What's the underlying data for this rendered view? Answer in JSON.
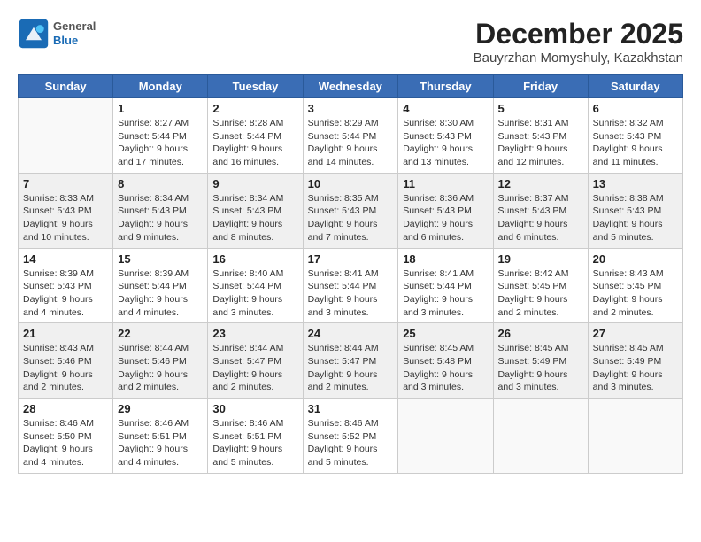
{
  "logo": {
    "general": "General",
    "blue": "Blue"
  },
  "title": "December 2025",
  "subtitle": "Bauyrzhan Momyshuly, Kazakhstan",
  "days_of_week": [
    "Sunday",
    "Monday",
    "Tuesday",
    "Wednesday",
    "Thursday",
    "Friday",
    "Saturday"
  ],
  "weeks": [
    [
      {
        "day": "",
        "info": ""
      },
      {
        "day": "1",
        "info": "Sunrise: 8:27 AM\nSunset: 5:44 PM\nDaylight: 9 hours\nand 17 minutes."
      },
      {
        "day": "2",
        "info": "Sunrise: 8:28 AM\nSunset: 5:44 PM\nDaylight: 9 hours\nand 16 minutes."
      },
      {
        "day": "3",
        "info": "Sunrise: 8:29 AM\nSunset: 5:44 PM\nDaylight: 9 hours\nand 14 minutes."
      },
      {
        "day": "4",
        "info": "Sunrise: 8:30 AM\nSunset: 5:43 PM\nDaylight: 9 hours\nand 13 minutes."
      },
      {
        "day": "5",
        "info": "Sunrise: 8:31 AM\nSunset: 5:43 PM\nDaylight: 9 hours\nand 12 minutes."
      },
      {
        "day": "6",
        "info": "Sunrise: 8:32 AM\nSunset: 5:43 PM\nDaylight: 9 hours\nand 11 minutes."
      }
    ],
    [
      {
        "day": "7",
        "info": "Sunrise: 8:33 AM\nSunset: 5:43 PM\nDaylight: 9 hours\nand 10 minutes."
      },
      {
        "day": "8",
        "info": "Sunrise: 8:34 AM\nSunset: 5:43 PM\nDaylight: 9 hours\nand 9 minutes."
      },
      {
        "day": "9",
        "info": "Sunrise: 8:34 AM\nSunset: 5:43 PM\nDaylight: 9 hours\nand 8 minutes."
      },
      {
        "day": "10",
        "info": "Sunrise: 8:35 AM\nSunset: 5:43 PM\nDaylight: 9 hours\nand 7 minutes."
      },
      {
        "day": "11",
        "info": "Sunrise: 8:36 AM\nSunset: 5:43 PM\nDaylight: 9 hours\nand 6 minutes."
      },
      {
        "day": "12",
        "info": "Sunrise: 8:37 AM\nSunset: 5:43 PM\nDaylight: 9 hours\nand 6 minutes."
      },
      {
        "day": "13",
        "info": "Sunrise: 8:38 AM\nSunset: 5:43 PM\nDaylight: 9 hours\nand 5 minutes."
      }
    ],
    [
      {
        "day": "14",
        "info": "Sunrise: 8:39 AM\nSunset: 5:43 PM\nDaylight: 9 hours\nand 4 minutes."
      },
      {
        "day": "15",
        "info": "Sunrise: 8:39 AM\nSunset: 5:44 PM\nDaylight: 9 hours\nand 4 minutes."
      },
      {
        "day": "16",
        "info": "Sunrise: 8:40 AM\nSunset: 5:44 PM\nDaylight: 9 hours\nand 3 minutes."
      },
      {
        "day": "17",
        "info": "Sunrise: 8:41 AM\nSunset: 5:44 PM\nDaylight: 9 hours\nand 3 minutes."
      },
      {
        "day": "18",
        "info": "Sunrise: 8:41 AM\nSunset: 5:44 PM\nDaylight: 9 hours\nand 3 minutes."
      },
      {
        "day": "19",
        "info": "Sunrise: 8:42 AM\nSunset: 5:45 PM\nDaylight: 9 hours\nand 2 minutes."
      },
      {
        "day": "20",
        "info": "Sunrise: 8:43 AM\nSunset: 5:45 PM\nDaylight: 9 hours\nand 2 minutes."
      }
    ],
    [
      {
        "day": "21",
        "info": "Sunrise: 8:43 AM\nSunset: 5:46 PM\nDaylight: 9 hours\nand 2 minutes."
      },
      {
        "day": "22",
        "info": "Sunrise: 8:44 AM\nSunset: 5:46 PM\nDaylight: 9 hours\nand 2 minutes."
      },
      {
        "day": "23",
        "info": "Sunrise: 8:44 AM\nSunset: 5:47 PM\nDaylight: 9 hours\nand 2 minutes."
      },
      {
        "day": "24",
        "info": "Sunrise: 8:44 AM\nSunset: 5:47 PM\nDaylight: 9 hours\nand 2 minutes."
      },
      {
        "day": "25",
        "info": "Sunrise: 8:45 AM\nSunset: 5:48 PM\nDaylight: 9 hours\nand 3 minutes."
      },
      {
        "day": "26",
        "info": "Sunrise: 8:45 AM\nSunset: 5:49 PM\nDaylight: 9 hours\nand 3 minutes."
      },
      {
        "day": "27",
        "info": "Sunrise: 8:45 AM\nSunset: 5:49 PM\nDaylight: 9 hours\nand 3 minutes."
      }
    ],
    [
      {
        "day": "28",
        "info": "Sunrise: 8:46 AM\nSunset: 5:50 PM\nDaylight: 9 hours\nand 4 minutes."
      },
      {
        "day": "29",
        "info": "Sunrise: 8:46 AM\nSunset: 5:51 PM\nDaylight: 9 hours\nand 4 minutes."
      },
      {
        "day": "30",
        "info": "Sunrise: 8:46 AM\nSunset: 5:51 PM\nDaylight: 9 hours\nand 5 minutes."
      },
      {
        "day": "31",
        "info": "Sunrise: 8:46 AM\nSunset: 5:52 PM\nDaylight: 9 hours\nand 5 minutes."
      },
      {
        "day": "",
        "info": ""
      },
      {
        "day": "",
        "info": ""
      },
      {
        "day": "",
        "info": ""
      }
    ]
  ]
}
